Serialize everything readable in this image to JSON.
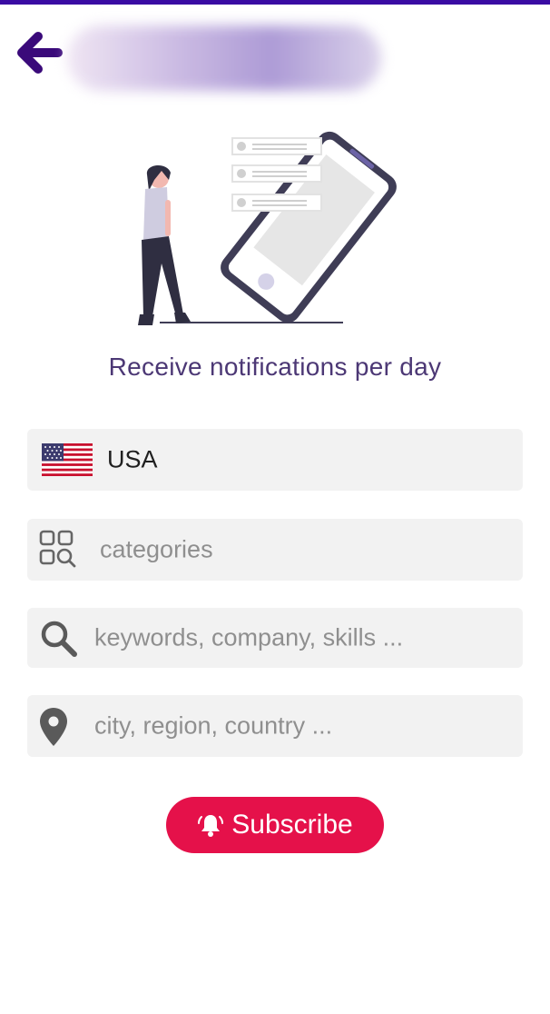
{
  "header": {
    "back_icon": "arrow-left-icon",
    "title_obscured": true
  },
  "main": {
    "heading": "Receive notifications per day",
    "country": {
      "value": "USA",
      "flag_icon": "us-flag-icon"
    },
    "categories": {
      "placeholder": "categories",
      "icon": "category-search-icon"
    },
    "keywords": {
      "placeholder": "keywords, company, skills ...",
      "icon": "search-icon"
    },
    "location": {
      "placeholder": "city, region, country ...",
      "icon": "location-pin-icon"
    },
    "subscribe": {
      "label": "Subscribe",
      "icon": "bell-ring-icon"
    }
  },
  "colors": {
    "accent": "#3a0ca3",
    "heading": "#4c3875",
    "button": "#e5114a",
    "field_bg": "#f2f2f2"
  }
}
